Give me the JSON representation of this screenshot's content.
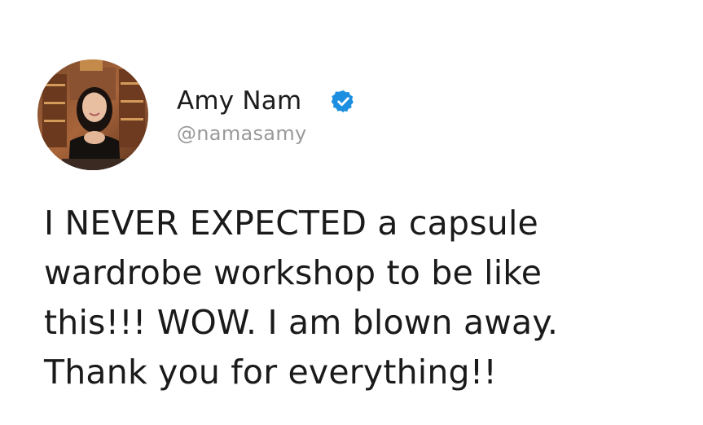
{
  "tweet": {
    "author": {
      "display_name": "Amy Nam",
      "handle": "@namasamy",
      "verified": true,
      "verified_badge_icon": "verified-badge-icon",
      "verified_color": "#1d8fe1",
      "avatar_icon": "profile-photo"
    },
    "text_lines": [
      "I NEVER EXPECTED a capsule",
      "wardrobe workshop to be like",
      "this!!! WOW. I am blown away.",
      "Thank you for everything!!"
    ]
  }
}
